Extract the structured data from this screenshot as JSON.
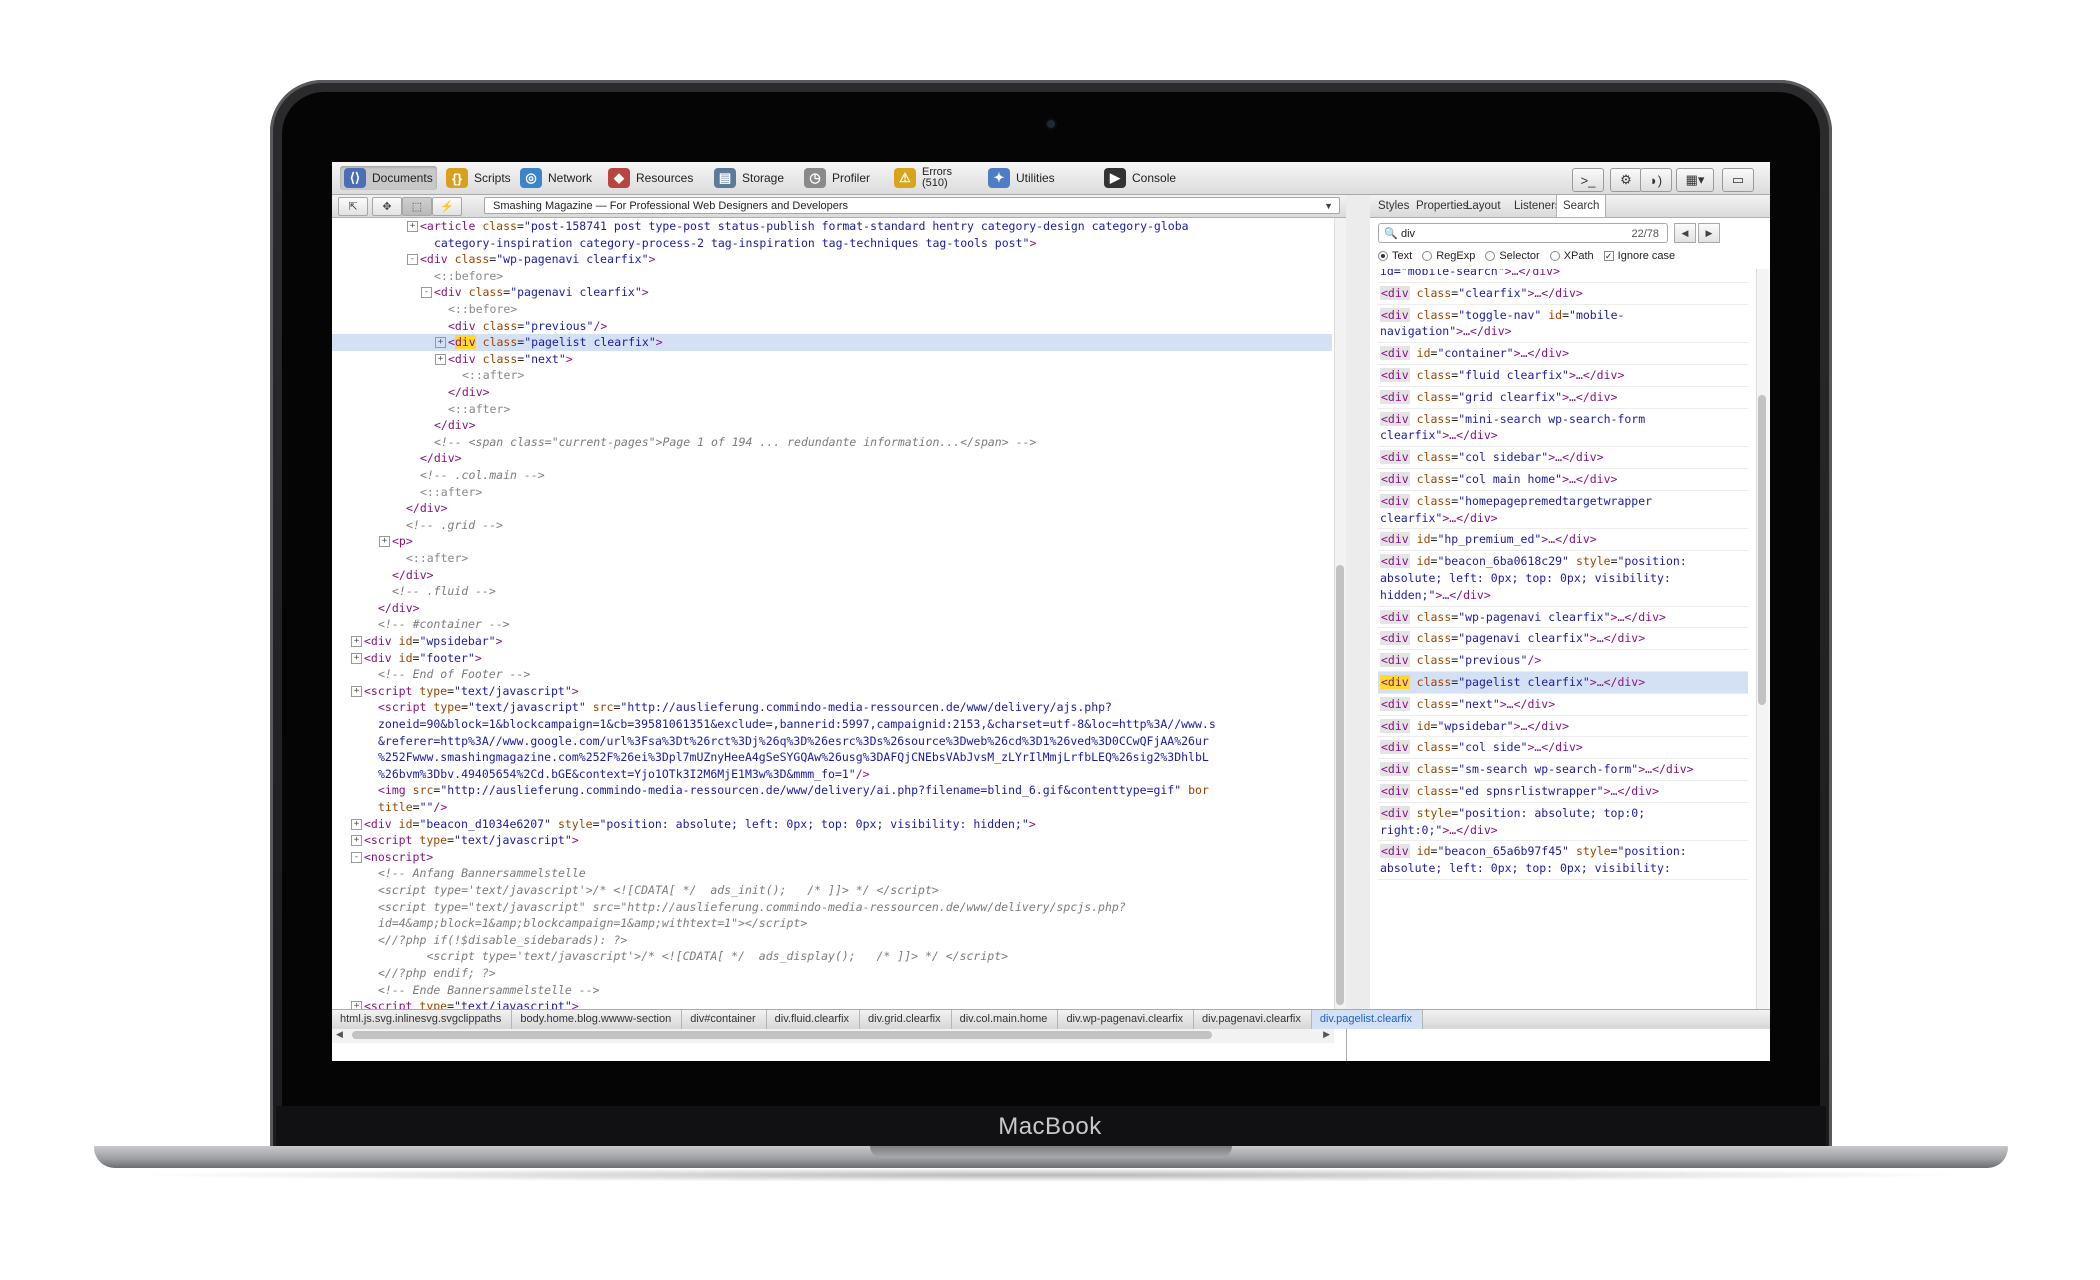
{
  "device": {
    "brand": "MacBook"
  },
  "toolbar": {
    "items": [
      {
        "label": "Documents",
        "icon": "documents-icon",
        "color": "#4a6fb5"
      },
      {
        "label": "Scripts",
        "icon": "scripts-icon",
        "color": "#d6a11e"
      },
      {
        "label": "Network",
        "icon": "network-icon",
        "color": "#3d83c9"
      },
      {
        "label": "Resources",
        "icon": "resources-icon",
        "color": "#b8463e"
      },
      {
        "label": "Storage",
        "icon": "storage-icon",
        "color": "#5d7a9a"
      },
      {
        "label": "Profiler",
        "icon": "profiler-icon",
        "color": "#8a8a8a"
      },
      {
        "label": "Errors",
        "sub": "(510)",
        "icon": "errors-icon",
        "color": "#d9a31c"
      },
      {
        "label": "Utilities",
        "icon": "utilities-icon",
        "color": "#4f7cc2"
      },
      {
        "label": "Console",
        "icon": "console-icon",
        "color": "#333333"
      }
    ],
    "right_buttons": [
      ">_",
      "⚙",
      "◗)",
      "▦▾",
      "▭"
    ]
  },
  "navbar": {
    "buttons": [
      "⇱",
      "✥",
      "⬚",
      "⚡"
    ],
    "page_select": "Smashing Magazine — For Professional Web Designers and Developers"
  },
  "code_lines": [
    {
      "indent": 12,
      "exp": "+",
      "html": "<span class='tg'>&lt;article</span> <span class='at'>class</span>=<span class='vl'>\"post-158741 post type-post status-publish format-standard hentry category-design category-globa</span>"
    },
    {
      "indent": 14,
      "exp": "",
      "html": "<span class='vl'>category-inspiration category-process-2 tag-inspiration tag-techniques tag-tools post\"</span><span class='tg'>&gt;</span>"
    },
    {
      "indent": 12,
      "exp": "-",
      "html": "<span class='tg'>&lt;div</span> <span class='at'>class</span>=<span class='vl'>\"wp-pagenavi clearfix\"</span><span class='tg'>&gt;</span>"
    },
    {
      "indent": 14,
      "exp": "",
      "html": "<span class='ps'>&lt;::before&gt;</span>"
    },
    {
      "indent": 14,
      "exp": "-",
      "html": "<span class='tg'>&lt;div</span> <span class='at'>class</span>=<span class='vl'>\"pagenavi clearfix\"</span><span class='tg'>&gt;</span>"
    },
    {
      "indent": 16,
      "exp": "",
      "html": "<span class='ps'>&lt;::before&gt;</span>"
    },
    {
      "indent": 16,
      "exp": "",
      "html": "<span class='tg'>&lt;div</span> <span class='at'>class</span>=<span class='vl'>\"previous\"</span><span class='tg'>/&gt;</span>"
    },
    {
      "indent": 16,
      "exp": "+",
      "hl": true,
      "html": "<span class='tg'>&lt;</span><span class='tg mark'>div</span> <span class='at'>class</span>=<span class='vl'>\"pagelist clearfix\"</span><span class='tg'>&gt;</span>"
    },
    {
      "indent": 16,
      "exp": "+",
      "html": "<span class='tg'>&lt;div</span> <span class='at'>class</span>=<span class='vl'>\"next\"</span><span class='tg'>&gt;</span>"
    },
    {
      "indent": 18,
      "exp": "",
      "html": "<span class='ps'>&lt;::after&gt;</span>"
    },
    {
      "indent": 16,
      "exp": "",
      "html": "<span class='tg'>&lt;/div&gt;</span>"
    },
    {
      "indent": 16,
      "exp": "",
      "html": "<span class='ps'>&lt;::after&gt;</span>"
    },
    {
      "indent": 14,
      "exp": "",
      "html": "<span class='tg'>&lt;/div&gt;</span>"
    },
    {
      "indent": 14,
      "exp": "",
      "html": "<span class='cm'>&lt;!-- &lt;span class=\"current-pages\"&gt;Page 1 of 194 ... redundante information...&lt;/span&gt; --&gt;</span>"
    },
    {
      "indent": 12,
      "exp": "",
      "html": "<span class='tg'>&lt;/div&gt;</span>"
    },
    {
      "indent": 12,
      "exp": "",
      "html": "<span class='cm'>&lt;!-- .col.main --&gt;</span>"
    },
    {
      "indent": 12,
      "exp": "",
      "html": "<span class='ps'>&lt;::after&gt;</span>"
    },
    {
      "indent": 10,
      "exp": "",
      "html": "<span class='tg'>&lt;/div&gt;</span>"
    },
    {
      "indent": 10,
      "exp": "",
      "html": "<span class='cm'>&lt;!-- .grid --&gt;</span>"
    },
    {
      "indent": 8,
      "exp": "+",
      "html": "<span class='tg'>&lt;p&gt;</span>"
    },
    {
      "indent": 10,
      "exp": "",
      "html": "<span class='ps'>&lt;::after&gt;</span>"
    },
    {
      "indent": 8,
      "exp": "",
      "html": "<span class='tg'>&lt;/div&gt;</span>"
    },
    {
      "indent": 8,
      "exp": "",
      "html": "<span class='cm'>&lt;!-- .fluid --&gt;</span>"
    },
    {
      "indent": 6,
      "exp": "",
      "html": "<span class='tg'>&lt;/div&gt;</span>"
    },
    {
      "indent": 6,
      "exp": "",
      "html": "<span class='cm'>&lt;!-- #container --&gt;</span>"
    },
    {
      "indent": 4,
      "exp": "+",
      "html": "<span class='tg'>&lt;div</span> <span class='at'>id</span>=<span class='vl'>\"wpsidebar\"</span><span class='tg'>&gt;</span>"
    },
    {
      "indent": 4,
      "exp": "+",
      "html": "<span class='tg'>&lt;div</span> <span class='at'>id</span>=<span class='vl'>\"footer\"</span><span class='tg'>&gt;</span>"
    },
    {
      "indent": 6,
      "exp": "",
      "html": "<span class='cm'>&lt;!-- End of Footer --&gt;</span>"
    },
    {
      "indent": 4,
      "exp": "+",
      "html": "<span class='tg'>&lt;script</span> <span class='at'>type</span>=<span class='vl'>\"text/javascript\"</span><span class='tg'>&gt;</span>"
    },
    {
      "indent": 6,
      "exp": "",
      "html": "<span class='tg'>&lt;script</span> <span class='at'>type</span>=<span class='vl'>\"text/javascript\"</span> <span class='at'>src</span>=<span class='vl'>\"http://auslieferung.commindo-media-ressourcen.de/www/delivery/ajs.php?</span>"
    },
    {
      "indent": 6,
      "exp": "",
      "html": "<span class='vl'>zoneid=90&amp;block=1&amp;blockcampaign=1&amp;cb=39581061351&amp;exclude=,bannerid:5997,campaignid:2153,&amp;charset=utf-8&amp;loc=http%3A//www.s</span>"
    },
    {
      "indent": 6,
      "exp": "",
      "html": "<span class='vl'>&amp;referer=http%3A//www.google.com/url%3Fsa%3Dt%26rct%3Dj%26q%3D%26esrc%3Ds%26source%3Dweb%26cd%3D1%26ved%3D0CCwQFjAA%26ur</span>"
    },
    {
      "indent": 6,
      "exp": "",
      "html": "<span class='vl'>%252Fwww.smashingmagazine.com%252F%26ei%3Dpl7mUZnyHeeA4gSeSYGQAw%26usg%3DAFQjCNEbsVAbJvsM_zLYrIlMmjLrfbLEQ%26sig2%3DhlbL</span>"
    },
    {
      "indent": 6,
      "exp": "",
      "html": "<span class='vl'>%26bvm%3Dbv.49405654%2Cd.bGE&amp;context=Yjo1OTk3I2M6MjE1M3w%3D&amp;mmm_fo=1\"</span><span class='tg'>/&gt;</span>"
    },
    {
      "indent": 6,
      "exp": "",
      "html": "<span class='tg'>&lt;img</span> <span class='at'>src</span>=<span class='vl'>\"http://auslieferung.commindo-media-ressourcen.de/www/delivery/ai.php?filename=blind_6.gif&amp;contenttype=gif\"</span> <span class='at'>bor</span>"
    },
    {
      "indent": 6,
      "exp": "",
      "html": "<span class='at'>title</span>=<span class='vl'>\"\"</span><span class='tg'>/&gt;</span>"
    },
    {
      "indent": 4,
      "exp": "+",
      "html": "<span class='tg'>&lt;div</span> <span class='at'>id</span>=<span class='vl'>\"beacon_d1034e6207\"</span> <span class='at'>style</span>=<span class='vl'>\"position: absolute; left: 0px; top: 0px; visibility: hidden;\"</span><span class='tg'>&gt;</span>"
    },
    {
      "indent": 4,
      "exp": "+",
      "html": "<span class='tg'>&lt;script</span> <span class='at'>type</span>=<span class='vl'>\"text/javascript\"</span><span class='tg'>&gt;</span>"
    },
    {
      "indent": 4,
      "exp": "-",
      "html": "<span class='tg'>&lt;noscript&gt;</span>"
    },
    {
      "indent": 6,
      "exp": "",
      "html": "<span class='cm'>&lt;!-- Anfang Bannersammelstelle</span>"
    },
    {
      "indent": 6,
      "exp": "",
      "html": "<span class='cm'>&lt;script type='text/javascript'&gt;/* &lt;![CDATA[ */  ads_init();   /* ]]&gt; */ &lt;/script&gt;</span>"
    },
    {
      "indent": 6,
      "exp": "",
      "html": "<span class='cm'>&lt;script type=\"text/javascript\" src=\"http://auslieferung.commindo-media-ressourcen.de/www/delivery/spcjs.php?</span>"
    },
    {
      "indent": 6,
      "exp": "",
      "html": "<span class='cm'>id=4&amp;amp;block=1&amp;amp;blockcampaign=1&amp;amp;withtext=1\"&gt;&lt;/script&gt;</span>"
    },
    {
      "indent": 6,
      "exp": "",
      "html": "<span class='cm'>&lt;//?php if(!$disable_sidebarads): ?&gt;</span>"
    },
    {
      "indent": 6,
      "exp": "",
      "html": "<span class='cm'>       &lt;script type='text/javascript'&gt;/* &lt;![CDATA[ */  ads_display();   /* ]]&gt; */ &lt;/script&gt;</span>"
    },
    {
      "indent": 6,
      "exp": "",
      "html": "<span class='cm'>&lt;//?php endif; ?&gt;</span>"
    },
    {
      "indent": 6,
      "exp": "",
      "html": "<span class='cm'>&lt;!-- Ende Bannersammelstelle --&gt;</span>"
    },
    {
      "indent": 4,
      "exp": "+",
      "html": "<span class='tg'>&lt;script</span> <span class='at'>type</span>=<span class='vl'>\"text/javascript\"</span><span class='tg'>&gt;</span>"
    }
  ],
  "breadcrumb": [
    "html.js.svg.inlinesvg.svgclippaths",
    "body.home.blog.wwww-section",
    "div#container",
    "div.fluid.clearfix",
    "div.grid.clearfix",
    "div.col.main.home",
    "div.wp-pagenavi.clearfix",
    "div.pagenavi.clearfix",
    "div.pagelist.clearfix"
  ],
  "sidebar_tabs": [
    "Styles",
    "Properties",
    "Layout",
    "Listeners",
    "Search"
  ],
  "search": {
    "query": "div",
    "count": "22/78",
    "options": [
      {
        "label": "Text",
        "type": "radio",
        "on": true
      },
      {
        "label": "RegExp",
        "type": "radio",
        "on": false
      },
      {
        "label": "Selector",
        "type": "radio",
        "on": false
      },
      {
        "label": "XPath",
        "type": "radio",
        "on": false
      },
      {
        "label": "Ignore case",
        "type": "check",
        "on": true
      }
    ]
  },
  "results": [
    {
      "lines": 1,
      "html": "<span class='vl'>id=\"mobile-search\"</span><span class='tg'>&gt;…&lt;/div&gt;</span>"
    },
    {
      "lines": 1,
      "html": "<span class='dv'>&lt;div</span> <span class='at'>class</span>=<span class='vl'>\"clearfix\"</span><span class='tg'>&gt;…&lt;/div&gt;</span>"
    },
    {
      "lines": 2,
      "html": "<span class='dv'>&lt;div</span> <span class='at'>class</span>=<span class='vl'>\"toggle-nav\"</span> <span class='at'>id</span>=<span class='vl'>\"mobile-\nnavigation\"</span><span class='tg'>&gt;…&lt;/div&gt;</span>"
    },
    {
      "lines": 1,
      "html": "<span class='dv'>&lt;div</span> <span class='at'>id</span>=<span class='vl'>\"container\"</span><span class='tg'>&gt;…&lt;/div&gt;</span>"
    },
    {
      "lines": 1,
      "html": "<span class='dv'>&lt;div</span> <span class='at'>class</span>=<span class='vl'>\"fluid clearfix\"</span><span class='tg'>&gt;…&lt;/div&gt;</span>"
    },
    {
      "lines": 1,
      "html": "<span class='dv'>&lt;div</span> <span class='at'>class</span>=<span class='vl'>\"grid clearfix\"</span><span class='tg'>&gt;…&lt;/div&gt;</span>"
    },
    {
      "lines": 2,
      "html": "<span class='dv'>&lt;div</span> <span class='at'>class</span>=<span class='vl'>\"mini-search wp-search-form\nclearfix\"</span><span class='tg'>&gt;…&lt;/div&gt;</span>"
    },
    {
      "lines": 1,
      "html": "<span class='dv'>&lt;div</span> <span class='at'>class</span>=<span class='vl'>\"col sidebar\"</span><span class='tg'>&gt;…&lt;/div&gt;</span>"
    },
    {
      "lines": 1,
      "html": "<span class='dv'>&lt;div</span> <span class='at'>class</span>=<span class='vl'>\"col main home\"</span><span class='tg'>&gt;…&lt;/div&gt;</span>"
    },
    {
      "lines": 2,
      "html": "<span class='dv'>&lt;div</span> <span class='at'>class</span>=<span class='vl'>\"homepagepremedtargetwrapper\nclearfix\"</span><span class='tg'>&gt;…&lt;/div&gt;</span>"
    },
    {
      "lines": 1,
      "html": "<span class='dv'>&lt;div</span> <span class='at'>id</span>=<span class='vl'>\"hp_premium_ed\"</span><span class='tg'>&gt;…&lt;/div&gt;</span>"
    },
    {
      "lines": 3,
      "html": "<span class='dv'>&lt;div</span> <span class='at'>id</span>=<span class='vl'>\"beacon_6ba0618c29\"</span> <span class='at'>style</span>=<span class='vl'>\"position:\nabsolute; left: 0px; top: 0px; visibility:\nhidden;\"</span><span class='tg'>&gt;…&lt;/div&gt;</span>"
    },
    {
      "lines": 1,
      "html": "<span class='dv'>&lt;div</span> <span class='at'>class</span>=<span class='vl'>\"wp-pagenavi clearfix\"</span><span class='tg'>&gt;…&lt;/div&gt;</span>"
    },
    {
      "lines": 1,
      "html": "<span class='dv'>&lt;div</span> <span class='at'>class</span>=<span class='vl'>\"pagenavi clearfix\"</span><span class='tg'>&gt;…&lt;/div&gt;</span>"
    },
    {
      "lines": 1,
      "html": "<span class='dv'>&lt;div</span> <span class='at'>class</span>=<span class='vl'>\"previous\"</span><span class='tg'>/&gt;</span>"
    },
    {
      "lines": 1,
      "sel": true,
      "html": "<span class='dv mark'>&lt;div</span> <span class='at'>class</span>=<span class='vl'>\"pagelist clearfix\"</span><span class='tg'>&gt;…&lt;/div&gt;</span>"
    },
    {
      "lines": 1,
      "html": "<span class='dv'>&lt;div</span> <span class='at'>class</span>=<span class='vl'>\"next\"</span><span class='tg'>&gt;…&lt;/div&gt;</span>"
    },
    {
      "lines": 1,
      "html": "<span class='dv'>&lt;div</span> <span class='at'>id</span>=<span class='vl'>\"wpsidebar\"</span><span class='tg'>&gt;…&lt;/div&gt;</span>"
    },
    {
      "lines": 1,
      "html": "<span class='dv'>&lt;div</span> <span class='at'>class</span>=<span class='vl'>\"col side\"</span><span class='tg'>&gt;…&lt;/div&gt;</span>"
    },
    {
      "lines": 1,
      "html": "<span class='dv'>&lt;div</span> <span class='at'>class</span>=<span class='vl'>\"sm-search wp-search-form\"</span><span class='tg'>&gt;…&lt;/div&gt;</span>"
    },
    {
      "lines": 1,
      "html": "<span class='dv'>&lt;div</span> <span class='at'>class</span>=<span class='vl'>\"ed spnsrlistwrapper\"</span><span class='tg'>&gt;…&lt;/div&gt;</span>"
    },
    {
      "lines": 2,
      "html": "<span class='dv'>&lt;div</span> <span class='at'>style</span>=<span class='vl'>\"position: absolute; top:0;\nright:0;\"</span><span class='tg'>&gt;…&lt;/div&gt;</span>"
    },
    {
      "lines": 2,
      "html": "<span class='dv'>&lt;div</span> <span class='at'>id</span>=<span class='vl'>\"beacon_65a6b97f45\"</span> <span class='at'>style</span>=<span class='vl'>\"position:\nabsolute; left: 0px; top: 0px; visibility:</span>"
    }
  ]
}
